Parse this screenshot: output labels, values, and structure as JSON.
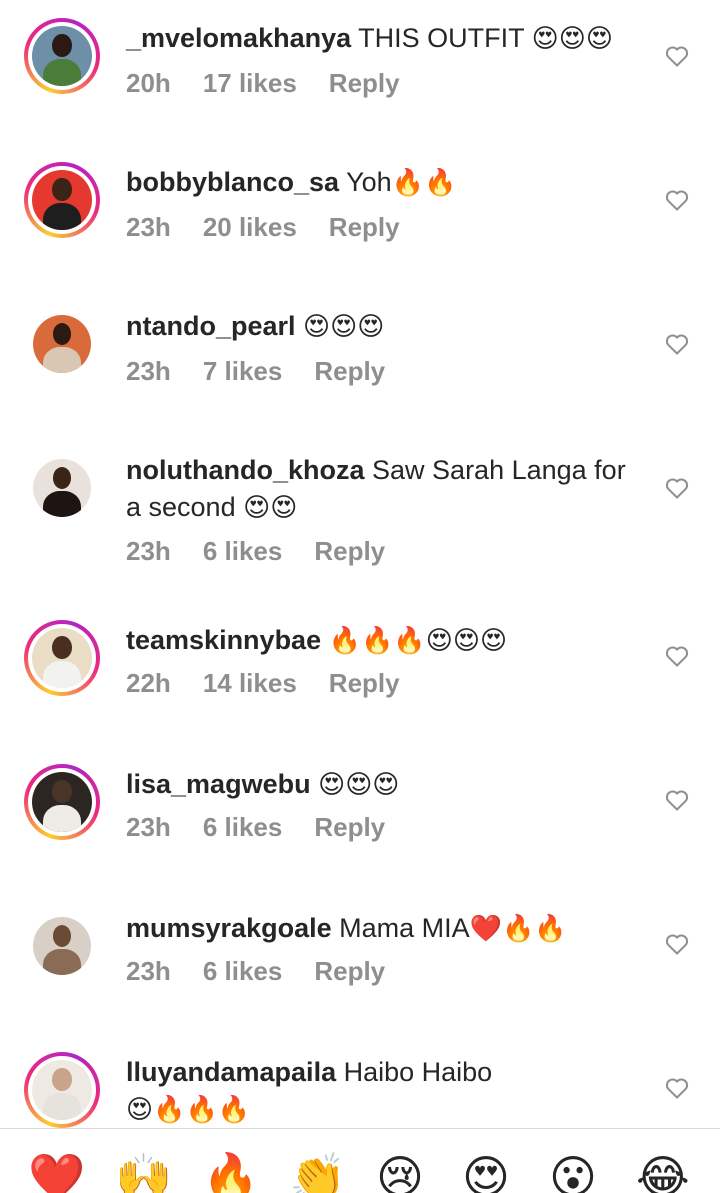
{
  "comments": [
    {
      "username": "_mvelomakhanya",
      "text": "THIS OUTFIT",
      "emojis": "😍😍😍",
      "time": "20h",
      "likes": "17 likes",
      "reply": "Reply",
      "story_ring": true,
      "head_color": "#2b1a14",
      "body_color": "#4a7d3a",
      "bg_color": "#6d8fa8"
    },
    {
      "username": "bobbyblanco_sa",
      "text": "Yoh",
      "emojis": "🔥🔥",
      "time": "23h",
      "likes": "20 likes",
      "reply": "Reply",
      "story_ring": true,
      "head_color": "#3b2416",
      "body_color": "#1e1e1e",
      "bg_color": "#e5382e"
    },
    {
      "username": "ntando_pearl",
      "text": "",
      "emojis": "😍😍😍",
      "time": "23h",
      "likes": "7 likes",
      "reply": "Reply",
      "story_ring": false,
      "head_color": "#2a1a12",
      "body_color": "#d9c7b3",
      "bg_color": "#d96a3a"
    },
    {
      "username": "noluthando_khoza",
      "text": "Saw Sarah Langa for a second",
      "emojis": "😍😍",
      "time": "23h",
      "likes": "6 likes",
      "reply": "Reply",
      "story_ring": false,
      "head_color": "#3a2418",
      "body_color": "#1c1512",
      "bg_color": "#e9e2dc"
    },
    {
      "username": "teamskinnybae",
      "text": "",
      "emojis": "🔥🔥🔥😍😍😍",
      "time": "22h",
      "likes": "14 likes",
      "reply": "Reply",
      "story_ring": true,
      "head_color": "#4a2e1f",
      "body_color": "#f2f2f0",
      "bg_color": "#e9ddc6"
    },
    {
      "username": "lisa_magwebu",
      "text": "",
      "emojis": "😍😍😍",
      "time": "23h",
      "likes": "6 likes",
      "reply": "Reply",
      "story_ring": true,
      "head_color": "#4a3428",
      "body_color": "#efece7",
      "bg_color": "#2b2622"
    },
    {
      "username": "mumsyrakgoale",
      "text": "Mama MIA",
      "emojis": "❤️🔥🔥",
      "time": "23h",
      "likes": "6 likes",
      "reply": "Reply",
      "story_ring": false,
      "head_color": "#6b4a36",
      "body_color": "#8a6c56",
      "bg_color": "#d8cfc6"
    },
    {
      "username": "lluyandamapaila",
      "text": "Haibo Haibo",
      "emojis": "😍🔥🔥🔥",
      "time": "",
      "likes": "",
      "reply": "",
      "story_ring": true,
      "head_color": "#c8a48a",
      "body_color": "#e6e2dc",
      "bg_color": "#efe9e3"
    }
  ],
  "reactions": [
    {
      "name": "red-heart",
      "glyph": "❤️"
    },
    {
      "name": "raising-hands",
      "glyph": "🙌"
    },
    {
      "name": "fire",
      "glyph": "🔥"
    },
    {
      "name": "clapping-hands",
      "glyph": "👏"
    },
    {
      "name": "crying-face",
      "glyph": "😢"
    },
    {
      "name": "heart-eyes",
      "glyph": "😍"
    },
    {
      "name": "surprised-face",
      "glyph": "😮"
    },
    {
      "name": "tears-of-joy",
      "glyph": "😂"
    }
  ],
  "colors": {
    "username": "#262626",
    "meta": "#8e8e8e",
    "heart_outline": "#8e8e8e"
  }
}
